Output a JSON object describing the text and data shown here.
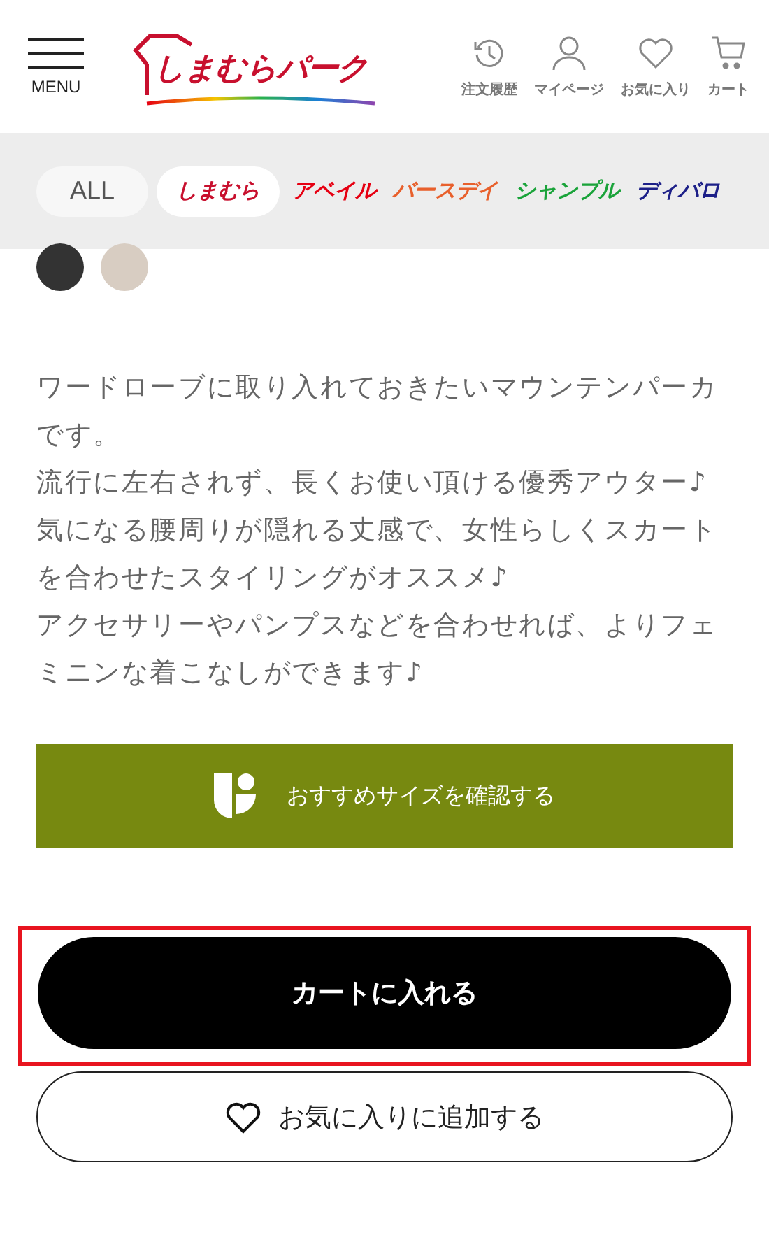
{
  "header": {
    "menu_label": "MENU",
    "logo": "しまむらパーク",
    "nav": [
      {
        "kind": "history",
        "label": "注文履歴"
      },
      {
        "kind": "user",
        "label": "マイページ"
      },
      {
        "kind": "heart",
        "label": "お気に入り"
      },
      {
        "kind": "cart",
        "label": "カート"
      }
    ]
  },
  "brands": [
    {
      "label": "ALL",
      "selected": false,
      "color": "#555555"
    },
    {
      "label": "しまむら",
      "selected": true,
      "color": "#c8102e"
    },
    {
      "label": "アベイル",
      "selected": false,
      "color": "#e60012"
    },
    {
      "label": "バースデイ",
      "selected": false,
      "color": "#e8602c"
    },
    {
      "label": "シャンプル",
      "selected": false,
      "color": "#1aa33a"
    },
    {
      "label": "ディバロ",
      "selected": false,
      "color": "#1d2088"
    }
  ],
  "swatches": [
    {
      "color": "#333333",
      "selected": false
    },
    {
      "color": "#d8cdc2",
      "selected": false
    }
  ],
  "description": [
    "ワードローブに取り入れておきたいマウンテンパーカです。",
    "流行に左右されず、長くお使い頂ける優秀アウター♪",
    "気になる腰周りが隠れる丈感で、女性らしくスカートを合わせたスタイリングがオススメ♪",
    "アクセサリーやパンプスなどを合わせれば、よりフェミニンな着こなしができます♪"
  ],
  "size_button": "おすすめサイズを確認する",
  "cart_button": {
    "label": "カートに入れる",
    "highlighted": true
  },
  "favorite_button": "お気に入りに追加する"
}
